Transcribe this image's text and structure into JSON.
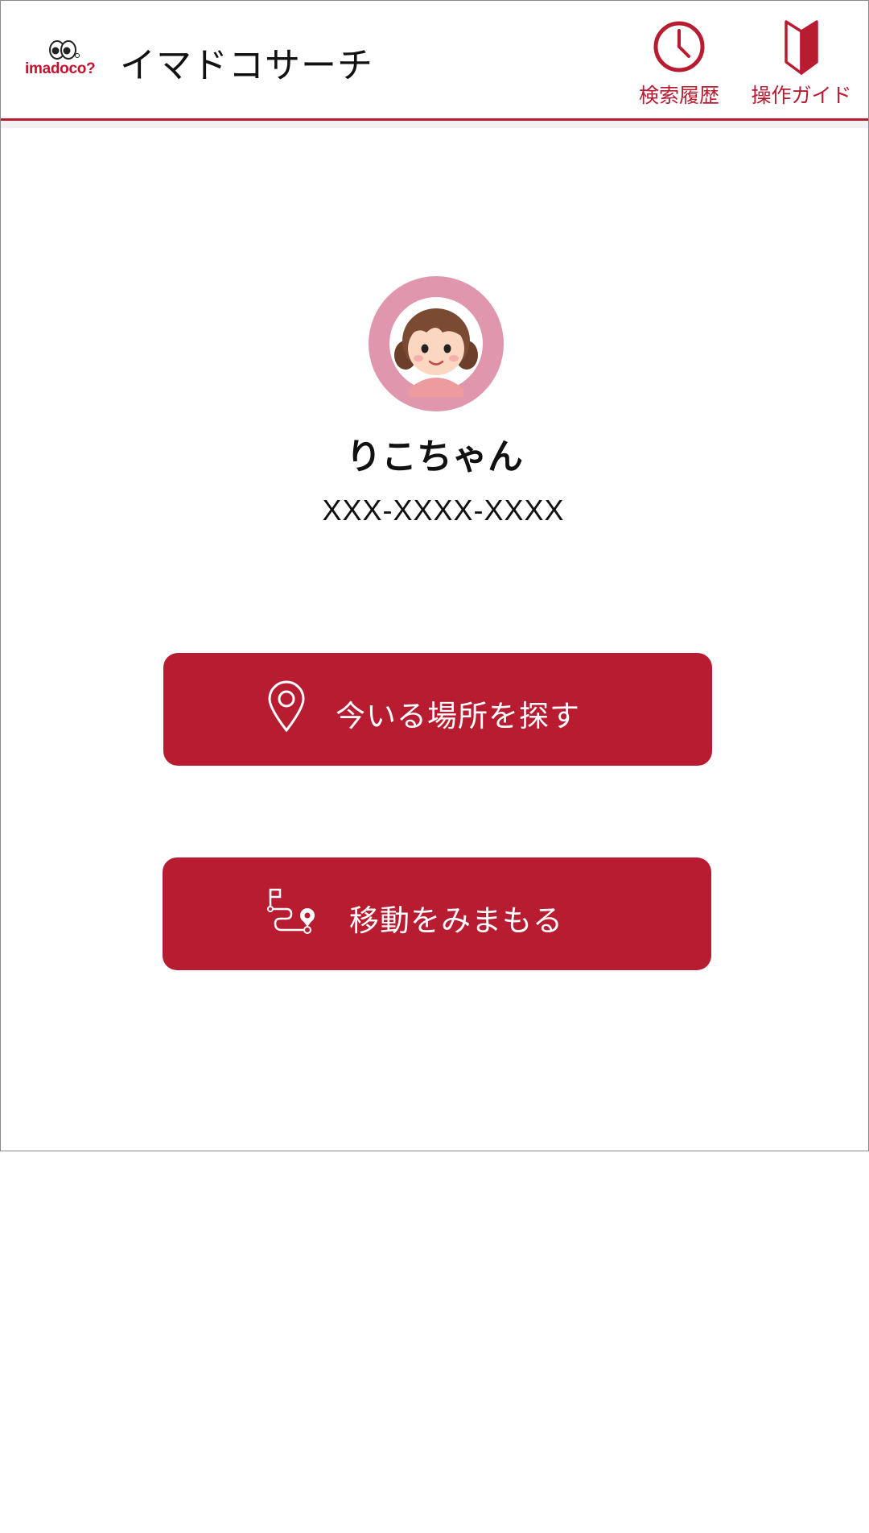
{
  "header": {
    "logo_text": "imadoco?",
    "title": "イマドコサーチ",
    "history_label": "検索履歴",
    "history_icon": "clock-icon",
    "guide_label": "操作ガイド",
    "guide_icon": "beginner-mark-icon"
  },
  "profile": {
    "name": "りこちゃん",
    "phone": "XXX-XXXX-XXXX",
    "avatar_icon": "girl-avatar-icon"
  },
  "actions": {
    "locate_label": "今いる場所を探す",
    "locate_icon": "location-pin-icon",
    "watch_label": "移動をみまもる",
    "watch_icon": "route-icon"
  },
  "colors": {
    "brand": "#b71c31",
    "avatar_ring": "#e096ac",
    "text": "#111111",
    "background": "#ffffff"
  }
}
